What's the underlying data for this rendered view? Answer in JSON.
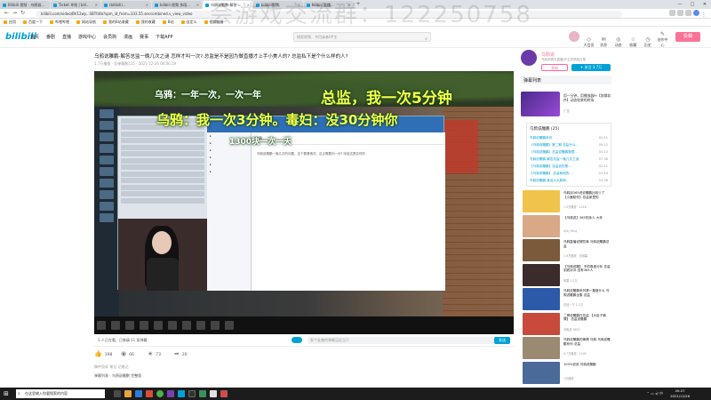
{
  "browser": {
    "tabs": [
      "Bilibili 视频 - 乌鸦说...",
      "Ticket 寻找 | bili...",
      "(bilibili)...",
      "bilibili 视频 多段...",
      "乌鸦说雕鹏-解答...",
      "bilibili视频",
      "bilibili 直播..."
    ],
    "new_tab": "+",
    "window_controls": [
      "—",
      "□",
      "✕"
    ],
    "url": "bilibili.com/video/BV12wy...SBTtl4b?spm_id_from=333.55.seccombined.v_view_video",
    "bookmarks": [
      "应用",
      "百度一下",
      "哔哩哔哩",
      "网站导航",
      "我的B站收藏",
      "我的收藏",
      "B站",
      "自定义",
      "视频链接"
    ]
  },
  "site": {
    "logo": "bilibili",
    "nav": [
      "首页",
      "番剧",
      "直播",
      "游戏中心",
      "会员购",
      "漫画",
      "赛事",
      "下载APP"
    ],
    "search_placeholder": "搜索视频、节目或者UP主",
    "header_icons": [
      "大会员",
      "消息",
      "动态",
      "收藏",
      "历史",
      "创作中心"
    ],
    "upload_label": "投稿"
  },
  "video": {
    "title": "乌鸦说雕鹏-解答总监一晚几次之谜 怎样才叫一次? 总监是不是因为做直播才上手小美人的? 总监私下是个什么样的人?",
    "meta": "1.7万播放 · 总弹幕数115 · 2021-12-26 00:06:19",
    "overlay_texts": [
      "总监，我一次5分钟",
      "乌鸦：一年一次，一次一年",
      "乌鸦：我一次3分钟。毒妇：没30分钟你",
      "1300块一次一天"
    ],
    "inner_mail_from": "乌鸦",
    "inner_mail_body": "乌鸦说雕鹏一晚几次的问题，这个要看情况，这点需要问一问? 哈哈这是实时的"
  },
  "controls": {
    "viewers": "1 人正在看，已装填 11 条弹幕",
    "danmaku_placeholder": "发个友善的弹幕见证当下",
    "send_label": "发送"
  },
  "actions": {
    "like": "198",
    "coin": "66",
    "favorite": "73",
    "share": "20"
  },
  "description": "稿件投诉  笔记  记笔记",
  "description2": "弹幕列表 · 乌鸦说雕鹏 完整版",
  "uploader": {
    "name": "乌鸦说",
    "sub": "乌鸦说聊天直播UP主的搞笑日常",
    "charge_label": "充电",
    "follow_label": "+ 关注 3.7万"
  },
  "danmu_list_label": "弹幕列表",
  "ad": {
    "title": "用一分钟，用播放器Pr【剪辑软件】动态效果的转场",
    "meta": "广告"
  },
  "list_box": {
    "title": "乌鸦说雕鹏 (25)",
    "items": [
      {
        "t": "乌鸦说雕鹏系列",
        "d": "01:21"
      },
      {
        "t": "《乌鸦说雕鹏》第二期 总监什么...",
        "d": "05:12"
      },
      {
        "t": "《乌鸦说雕鹏》总监说雕鹏哪里...",
        "d": "01:13"
      },
      {
        "t": "乌鸦说雕鹏-解答总监一晚几次之谜",
        "d": "07:36"
      },
      {
        "t": "【乌鸦说雕鹏】总监说的是...",
        "d": "02:21"
      },
      {
        "t": "【乌鸦说雕鹏】 总监和他的...",
        "d": "01:44"
      },
      {
        "t": "乌鸦说雕鹏-谁这么大胆和...",
        "d": "01:36"
      }
    ]
  },
  "recommendations": [
    {
      "title": "乌鸦谈365说说雕鹏比较少了 【小鹿制作】总监家里的",
      "meta": "1.9万播放 · 1216",
      "color": "#f0c34a"
    },
    {
      "title": "【乌鸦说】365的亲人 大年",
      "meta": "Ayb_Pang",
      "color": "#d9a887"
    },
    {
      "title": "乌鸦直播说哪些事 乌鸦说雕鹏总监",
      "meta": "1.9万播放 · 总弹幕",
      "color": "#7b5a3b"
    },
    {
      "title": "【乌鸦说雕】 不同角度分析 总监到底对冲 没有365人",
      "meta": "苹果 1.2万",
      "color": "#3b2b2b"
    },
    {
      "title": "乌鸦说雕鹏系列第一集做什么 乌鸦说雕鹏全集 总监",
      "meta": "总结一下 1.1万",
      "color": "#2d5aa8"
    },
    {
      "title": "二哥说雕鹏在总监 【大肚子事情】 总监说雕鹏",
      "meta": "乌鸦说 9822",
      "color": "#c74a3a"
    },
    {
      "title": "乌鸦说雕鹏的事情 乌鸦 乌鸦说雕鹏系列 总监",
      "meta": "9.7万播放 · 1245",
      "color": "#9a8a72"
    },
    {
      "title": "100%说说 乌鸦说雕鹏",
      "meta": "1万播放",
      "color": "#4a6a9a"
    }
  ],
  "os": {
    "start": "⊞",
    "search_placeholder": "在这里输入你要搜索的内容",
    "time": "20:27",
    "date": "2021/12/26"
  },
  "watermark": "会游戏交流群：122250758"
}
